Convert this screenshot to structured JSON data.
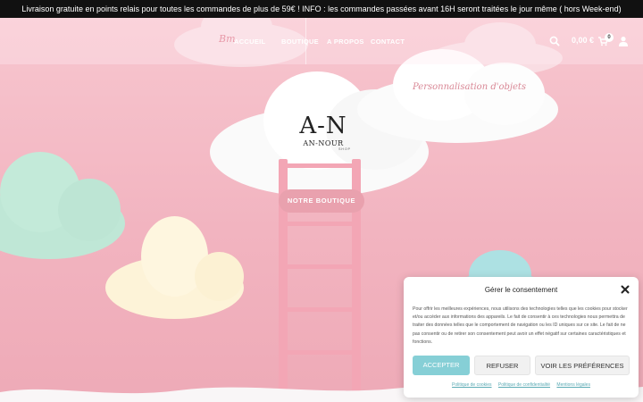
{
  "announcement": "Livraison gratuite en points relais pour toutes les commandes de plus de 59€ ! INFO : les commandes passées avant 16H seront traitées le jour même ( hors Week-end)",
  "header": {
    "logo_script": "Bm",
    "nav": [
      "ACCUEIL",
      "BOUTIQUE",
      "A PROPOS",
      "CONTACT"
    ],
    "cart_total": "0,00 €",
    "cart_count": "0",
    "icons": [
      "search-icon",
      "cart-icon",
      "user-icon"
    ]
  },
  "hero": {
    "subtitle_script": "Personnalisation d'objets",
    "brand_monogram": "A-N",
    "brand_name": "AN-NOUR",
    "brand_tag": "SHOP",
    "cta": "NOTRE BOUTIQUE"
  },
  "consent": {
    "title": "Gérer le consentement",
    "body": "Pour offrir les meilleures expériences, nous utilisons des technologies telles que les cookies pour stocker et/ou accéder aux informations des appareils. Le fait de consentir à ces technologies nous permettra de traiter des données telles que le comportement de navigation ou les ID uniques sur ce site. Le fait de ne pas consentir ou de retirer son consentement peut avoir un effet négatif sur certaines caractéristiques et fonctions.",
    "accept": "ACCEPTER",
    "refuse": "REFUSER",
    "preferences": "VOIR LES PRÉFÉRENCES",
    "links": [
      "Politique de cookies",
      "Politique de confidentialité",
      "Mentions légales"
    ]
  },
  "colors": {
    "accent_pink": "#e9a1ae",
    "accent_teal": "#86cfd6",
    "background": "#f2b8c2"
  }
}
